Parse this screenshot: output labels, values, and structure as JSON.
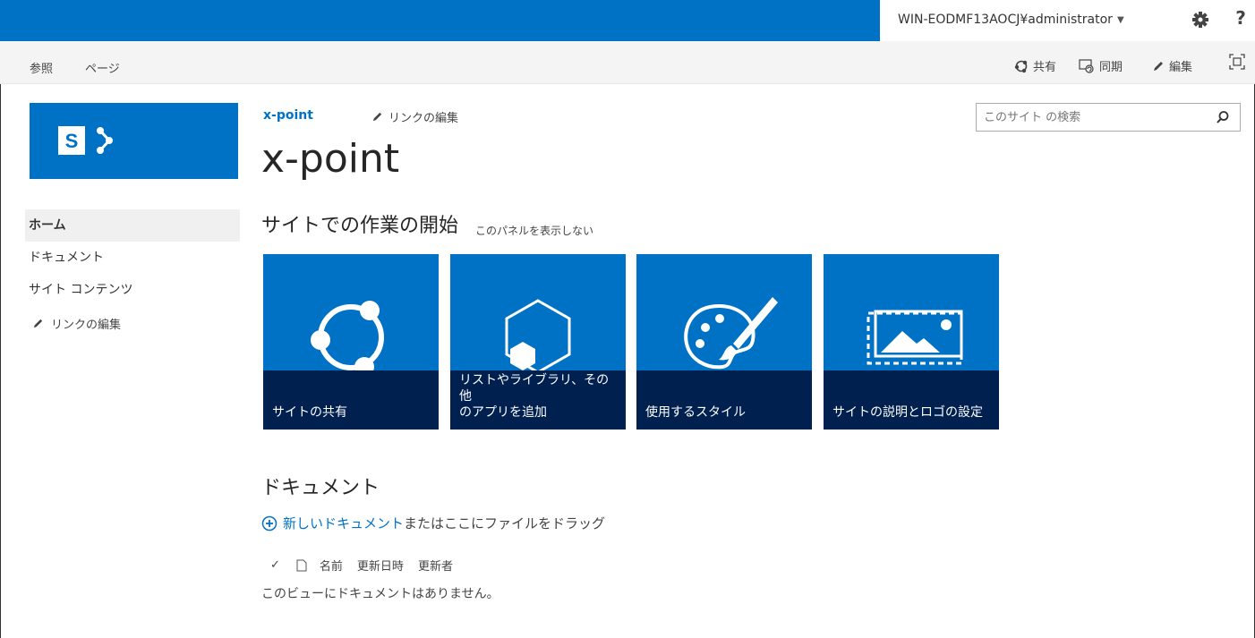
{
  "suitebar": {
    "user": "WIN-EODMF13AOCJ¥administrator",
    "help": "?",
    "accent": "#0072c6"
  },
  "ribbon": {
    "tabs": [
      "参照",
      "ページ"
    ],
    "actions": [
      {
        "label": "共有",
        "icon": "share-icon"
      },
      {
        "label": "同期",
        "icon": "sync-icon"
      },
      {
        "label": "編集",
        "icon": "edit-pencil-icon"
      }
    ]
  },
  "header": {
    "site_link": "x-point",
    "edit_links": "リンクの編集",
    "title": "x-point"
  },
  "search": {
    "placeholder": "このサイト の検索"
  },
  "leftnav": {
    "items": [
      {
        "label": "ホーム",
        "selected": true
      },
      {
        "label": "ドキュメント"
      },
      {
        "label": "サイト コンテンツ"
      }
    ],
    "edit_links": "リンクの編集"
  },
  "getting_started": {
    "title": "サイトでの作業の開始",
    "hide": "このパネルを表示しない",
    "tiles": [
      {
        "label": "サイトの共有",
        "icon": "share-site-icon"
      },
      {
        "label": "リストやライブラリ、その他\nのアプリを追加",
        "line1": "リストやライブラリ、その他",
        "line2": "のアプリを追加",
        "icon": "add-app-icon"
      },
      {
        "label": "使用するスタイル",
        "icon": "palette-icon"
      },
      {
        "label": "サイトの説明とロゴの設定",
        "icon": "image-icon"
      }
    ]
  },
  "documents": {
    "title": "ドキュメント",
    "new_link": "新しいドキュメント",
    "new_rest": "またはここにファイルをドラッグ",
    "columns": [
      "名前",
      "更新日時",
      "更新者"
    ],
    "empty": "このビューにドキュメントはありません。"
  }
}
